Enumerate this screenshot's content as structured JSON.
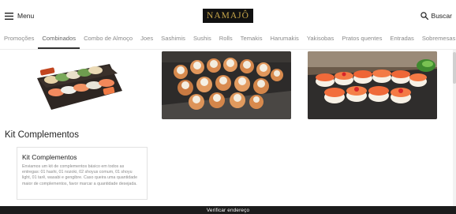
{
  "header": {
    "menu_label": "Menu",
    "logo_text": "NAMAJÔ",
    "search_label": "Buscar"
  },
  "tabs": [
    {
      "label": "Promoções",
      "active": false
    },
    {
      "label": "Combinados",
      "active": true
    },
    {
      "label": "Combo de Almoço",
      "active": false
    },
    {
      "label": "Joes",
      "active": false
    },
    {
      "label": "Sashimis",
      "active": false
    },
    {
      "label": "Sushis",
      "active": false
    },
    {
      "label": "Rolls",
      "active": false
    },
    {
      "label": "Temakis",
      "active": false
    },
    {
      "label": "Harumakis",
      "active": false
    },
    {
      "label": "Yakisobas",
      "active": false
    },
    {
      "label": "Pratos quentes",
      "active": false
    },
    {
      "label": "Entradas",
      "active": false
    },
    {
      "label": "Sobremesas",
      "active": false
    }
  ],
  "section": {
    "title": "Kit Complementos",
    "card_title": "Kit Complementos",
    "card_description": "Enviamos um kit de complementos básico em todos as entregas: 01 hashi, 01 nozoki, 02 shoyus comum, 01 shoyu light, 01 tarê, wasabi e gengibre. Caso queira uma quantidade maior de complementos, favor marcar a quantidade desejada."
  },
  "footer": {
    "button_label": "Verificar endereço"
  },
  "colors": {
    "logo_bg": "#111111",
    "logo_text": "#c7a64a",
    "bottom_bar": "#1c1c1c"
  },
  "icons": {
    "menu": "hamburger-icon",
    "search": "search-icon"
  }
}
